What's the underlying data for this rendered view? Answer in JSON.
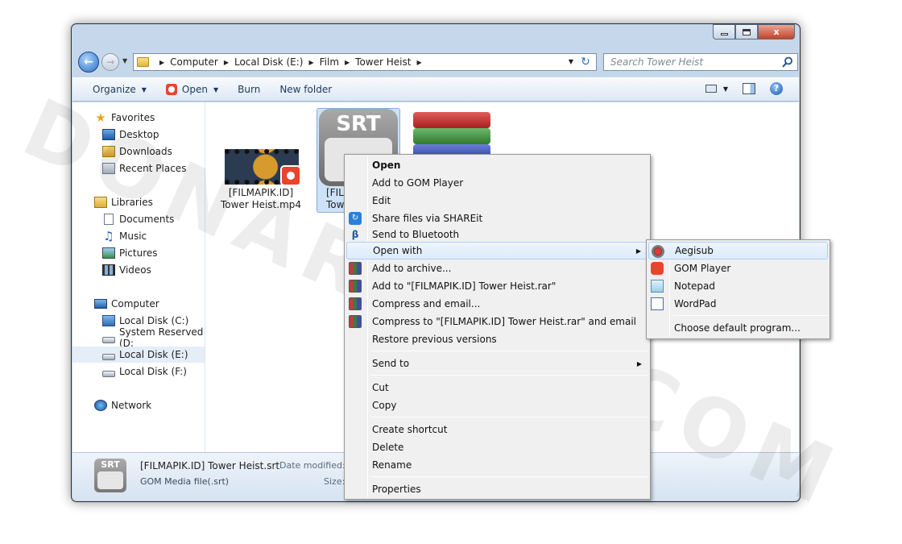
{
  "watermark": "DONARSMA.COM",
  "window": {
    "title_buttons": {
      "close": "x"
    }
  },
  "nav": {
    "breadcrumbs": [
      "Computer",
      "Local Disk (E:)",
      "Film",
      "Tower Heist"
    ],
    "search_placeholder": "Search Tower Heist"
  },
  "toolbar": {
    "organize": "Organize",
    "open": "Open",
    "burn": "Burn",
    "new_folder": "New folder"
  },
  "sidebar": {
    "favorites": "Favorites",
    "desktop": "Desktop",
    "downloads": "Downloads",
    "recent_places": "Recent Places",
    "libraries": "Libraries",
    "documents": "Documents",
    "music": "Music",
    "pictures": "Pictures",
    "videos": "Videos",
    "computer": "Computer",
    "local_c": "Local Disk (C:)",
    "system_reserved": "System Reserved (D:",
    "local_e": "Local Disk (E:)",
    "local_f": "Local Disk (F:)",
    "network": "Network"
  },
  "files": {
    "mp4_line1": "[FILMAPIK.ID]",
    "mp4_line2": "Tower Heist.mp4",
    "srt_line1": "[FILM",
    "srt_line2": "Towe",
    "srt_badge": "SRT"
  },
  "details": {
    "badge": "SRT",
    "name": "[FILMAPIK.ID] Tower Heist.srt",
    "modified_label": "Date modified:",
    "type": "GOM Media file(.srt)",
    "size_label": "Size:"
  },
  "context_menu": {
    "open": "Open",
    "add_gom": "Add to GOM Player",
    "edit": "Edit",
    "shareit": "Share files via SHAREit",
    "bluetooth": "Send to Bluetooth",
    "open_with": "Open with",
    "add_archive": "Add to archive...",
    "add_rar": "Add to \"[FILMAPIK.ID] Tower Heist.rar\"",
    "compress_email": "Compress and email...",
    "compress_rar_email": "Compress to \"[FILMAPIK.ID] Tower Heist.rar\" and email",
    "restore": "Restore previous versions",
    "send_to": "Send to",
    "cut": "Cut",
    "copy": "Copy",
    "create_shortcut": "Create shortcut",
    "delete": "Delete",
    "rename": "Rename",
    "properties": "Properties"
  },
  "submenu": {
    "aegisub": "Aegisub",
    "gom": "GOM Player",
    "notepad": "Notepad",
    "wordpad": "WordPad",
    "choose_default": "Choose default program..."
  }
}
